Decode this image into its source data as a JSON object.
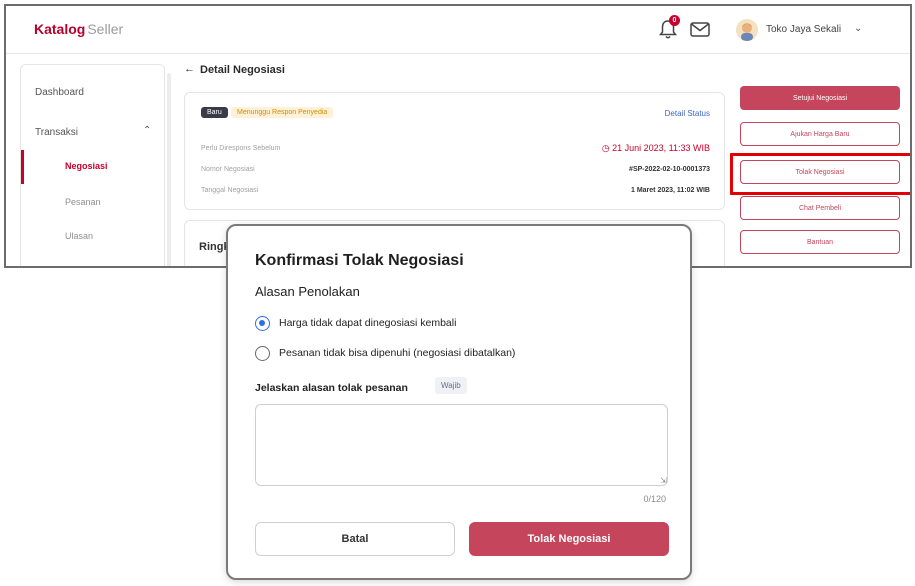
{
  "colors": {
    "brand": "#c8002c",
    "primary_button": "#c4455c",
    "highlight": "#e30000",
    "radio_selected": "#2f6ee0"
  },
  "header": {
    "logo_text": "Katalog",
    "logo_suffix": "Seller",
    "notification_count": "0",
    "store_name": "Toko Jaya Sekali",
    "icons": [
      "bell-icon",
      "mail-icon",
      "avatar",
      "chevron-down-icon"
    ]
  },
  "sidebar": {
    "dashboard": "Dashboard",
    "transaksi": "Transaksi",
    "negosiasi": "Negosiasi",
    "pesanan": "Pesanan",
    "ulasan": "Ulasan"
  },
  "page": {
    "title": "Detail Negosiasi",
    "badge_new": "Baru",
    "badge_status": "Menunggu Respon Penyedia",
    "detail_status_link": "Detail Status",
    "rows": [
      {
        "label": "Perlu Direspons Sebelum",
        "value": "21 Juni 2023, 11:33 WIB"
      },
      {
        "label": "Nomor Negosiasi",
        "value": "#SP-2022-02-10-0001373"
      },
      {
        "label": "Tanggal Negosiasi",
        "value": "1 Maret 2023, 11:02 WIB"
      }
    ],
    "ringkasan_title": "Ringk"
  },
  "actions": {
    "setujui": "Setujui Negosiasi",
    "ajukan": "Ajukan Harga Baru",
    "tolak": "Tolak Negosiasi",
    "chat": "Chat Pembeli",
    "bantuan": "Bantuan"
  },
  "modal": {
    "title": "Konfirmasi Tolak Negosiasi",
    "subtitle": "Alasan Penolakan",
    "options": [
      {
        "label": "Harga tidak dapat dinegosiasi kembali",
        "selected": true
      },
      {
        "label": "Pesanan tidak bisa dipenuhi (negosiasi dibatalkan)",
        "selected": false
      }
    ],
    "reason_label": "Jelaskan alasan tolak pesanan",
    "required_tag": "Wajib",
    "reason_value": "",
    "counter": "0/120",
    "cancel_label": "Batal",
    "confirm_label": "Tolak Negosiasi"
  }
}
